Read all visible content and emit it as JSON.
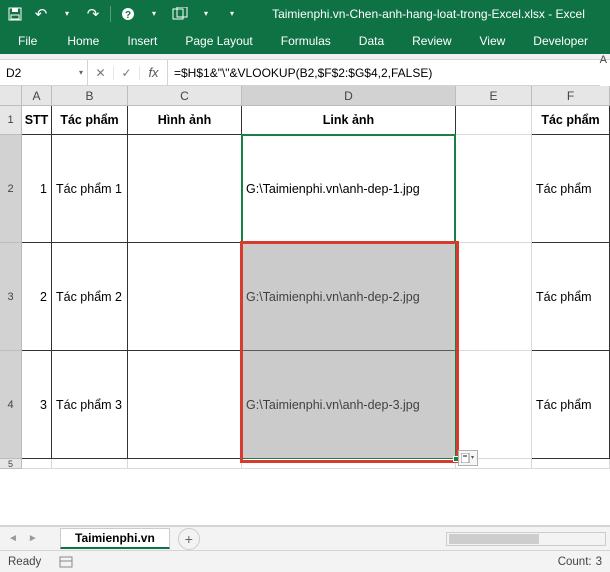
{
  "title": "Taimienphi.vn-Chen-anh-hang-loat-trong-Excel.xlsx - Excel",
  "qat": {
    "save": "💾",
    "undo": "↶",
    "redo": "↷",
    "help": "?",
    "new": "new"
  },
  "tabs": [
    "File",
    "Home",
    "Insert",
    "Page Layout",
    "Formulas",
    "Data",
    "Review",
    "View",
    "Developer"
  ],
  "toolbar_letter": "A",
  "namebox": "D2",
  "fx": {
    "cancel": "✕",
    "enter": "✓",
    "label": "fx"
  },
  "formula": "=$H$1&\"\\\"&VLOOKUP(B2,$F$2:$G$4,2,FALSE)",
  "cols": [
    "A",
    "B",
    "C",
    "D",
    "E",
    "F"
  ],
  "rows": [
    "1",
    "2",
    "3",
    "4",
    "5"
  ],
  "headers": {
    "A": "STT",
    "B": "Tác phẩm",
    "C": "Hình ảnh",
    "D": "Link ảnh",
    "F": "Tác phẩm"
  },
  "data": [
    {
      "stt": "1",
      "tp": "Tác phẩm 1",
      "link": "G:\\Taimienphi.vn\\anh-dep-1.jpg",
      "tpf": "Tác phẩm"
    },
    {
      "stt": "2",
      "tp": "Tác phẩm 2",
      "link": "G:\\Taimienphi.vn\\anh-dep-2.jpg",
      "tpf": "Tác phẩm"
    },
    {
      "stt": "3",
      "tp": "Tác phẩm 3",
      "link": "G:\\Taimienphi.vn\\anh-dep-3.jpg",
      "tpf": "Tác phẩm"
    }
  ],
  "sheet": {
    "name": "Taimienphi.vn",
    "add": "+"
  },
  "status": {
    "ready": "Ready",
    "count_label": "Count:",
    "count": "3"
  }
}
